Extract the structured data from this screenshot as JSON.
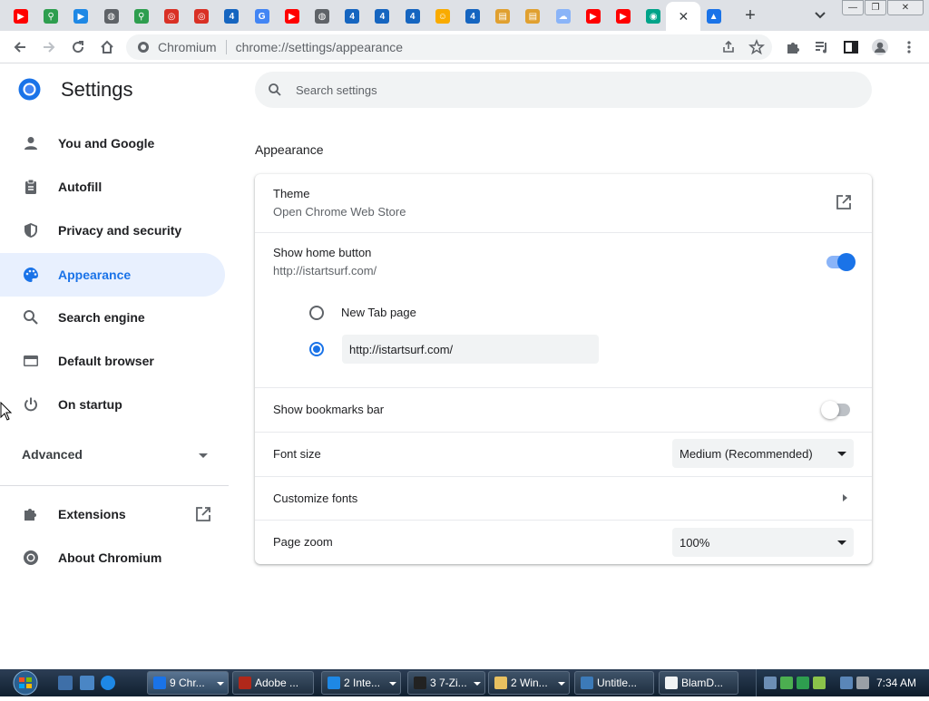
{
  "tabs": [
    {
      "icon": "youtube-icon",
      "color": "#ff0000",
      "glyph": "▶"
    },
    {
      "icon": "search-magnifier-icon",
      "color": "#2e9e4f",
      "glyph": "⚲"
    },
    {
      "icon": "play-circle-icon",
      "color": "#1e88e5",
      "glyph": "▶"
    },
    {
      "icon": "globe-icon",
      "color": "#5f6368",
      "glyph": "◍"
    },
    {
      "icon": "search-magnifier-icon",
      "color": "#2e9e4f",
      "glyph": "⚲"
    },
    {
      "icon": "red-oval-icon",
      "color": "#d93025",
      "glyph": "◎"
    },
    {
      "icon": "red-oval-icon",
      "color": "#d93025",
      "glyph": "◎"
    },
    {
      "icon": "number-four-icon",
      "color": "#1565c0",
      "glyph": "4"
    },
    {
      "icon": "google-icon",
      "color": "#4285f4",
      "glyph": "G"
    },
    {
      "icon": "youtube-icon",
      "color": "#ff0000",
      "glyph": "▶"
    },
    {
      "icon": "globe-icon",
      "color": "#5f6368",
      "glyph": "◍"
    },
    {
      "icon": "number-four-icon",
      "color": "#1565c0",
      "glyph": "4"
    },
    {
      "icon": "number-four-icon",
      "color": "#1565c0",
      "glyph": "4"
    },
    {
      "icon": "number-four-icon",
      "color": "#1565c0",
      "glyph": "4"
    },
    {
      "icon": "smiley-icon",
      "color": "#f9ab00",
      "glyph": "☺"
    },
    {
      "icon": "number-four-icon",
      "color": "#1565c0",
      "glyph": "4"
    },
    {
      "icon": "document-icon",
      "color": "#e0a030",
      "glyph": "▤"
    },
    {
      "icon": "document-icon",
      "color": "#e0a030",
      "glyph": "▤"
    },
    {
      "icon": "cloud-icon",
      "color": "#8ab4f8",
      "glyph": "☁"
    },
    {
      "icon": "youtube-icon",
      "color": "#ff0000",
      "glyph": "▶"
    },
    {
      "icon": "youtube-icon",
      "color": "#ff0000",
      "glyph": "▶"
    },
    {
      "icon": "teal-ring-icon",
      "color": "#00a389",
      "glyph": "◉"
    },
    {
      "icon": "chromium-icon",
      "color": "#1a73e8",
      "glyph": "✕",
      "active": true
    },
    {
      "icon": "flask-icon",
      "color": "#1a73e8",
      "glyph": "▲"
    }
  ],
  "toolbar": {
    "site_label": "Chromium",
    "url": "chrome://settings/appearance"
  },
  "settings": {
    "title": "Settings",
    "search_placeholder": "Search settings",
    "nav": [
      {
        "label": "You and Google",
        "icon": "person-icon"
      },
      {
        "label": "Autofill",
        "icon": "clipboard-icon"
      },
      {
        "label": "Privacy and security",
        "icon": "shield-icon"
      },
      {
        "label": "Appearance",
        "icon": "palette-icon",
        "selected": true
      },
      {
        "label": "Search engine",
        "icon": "search-icon"
      },
      {
        "label": "Default browser",
        "icon": "browser-window-icon"
      },
      {
        "label": "On startup",
        "icon": "power-icon"
      }
    ],
    "advanced_label": "Advanced",
    "extra": [
      {
        "label": "Extensions",
        "icon": "puzzle-icon"
      },
      {
        "label": "About Chromium",
        "icon": "chromium-icon"
      }
    ]
  },
  "appearance": {
    "section_title": "Appearance",
    "theme": {
      "title": "Theme",
      "subtitle": "Open Chrome Web Store"
    },
    "home_button": {
      "title": "Show home button",
      "subtitle": "http://istartsurf.com/",
      "enabled": true
    },
    "home_options": {
      "new_tab_label": "New Tab page",
      "custom_url": "http://istartsurf.com/",
      "selected": "custom"
    },
    "bookmarks_bar": {
      "title": "Show bookmarks bar",
      "enabled": false
    },
    "font_size": {
      "title": "Font size",
      "value": "Medium (Recommended)"
    },
    "customize_fonts": {
      "title": "Customize fonts"
    },
    "page_zoom": {
      "title": "Page zoom",
      "value": "100%"
    }
  },
  "taskbar": {
    "tasks": [
      {
        "label": "9 Chr...",
        "icon": "chromium-icon",
        "color": "#1a73e8",
        "dropdown": true,
        "active": true
      },
      {
        "label": "Adobe ...",
        "icon": "adobe-flash-icon",
        "color": "#b0281a",
        "dropdown": false
      },
      {
        "label": "2 Inte...",
        "icon": "internet-explorer-icon",
        "color": "#1e88e5",
        "dropdown": true
      },
      {
        "label": "3 7-Zi...",
        "icon": "seven-zip-icon",
        "color": "#222222",
        "dropdown": true
      },
      {
        "label": "2 Win...",
        "icon": "folder-icon",
        "color": "#e8c060",
        "dropdown": true
      },
      {
        "label": "Untitle...",
        "icon": "window-icon",
        "color": "#3c7ab8",
        "dropdown": false
      },
      {
        "label": "BlamD...",
        "icon": "document-icon",
        "color": "#f1f3f4",
        "dropdown": false
      }
    ],
    "clock": "7:34 AM"
  },
  "colors": {
    "accent": "#1a73e8",
    "nav_selected_bg": "#e8f0fe",
    "toggle_on_track": "#8ab4f8",
    "toggle_off_track": "#bdc1c6"
  }
}
